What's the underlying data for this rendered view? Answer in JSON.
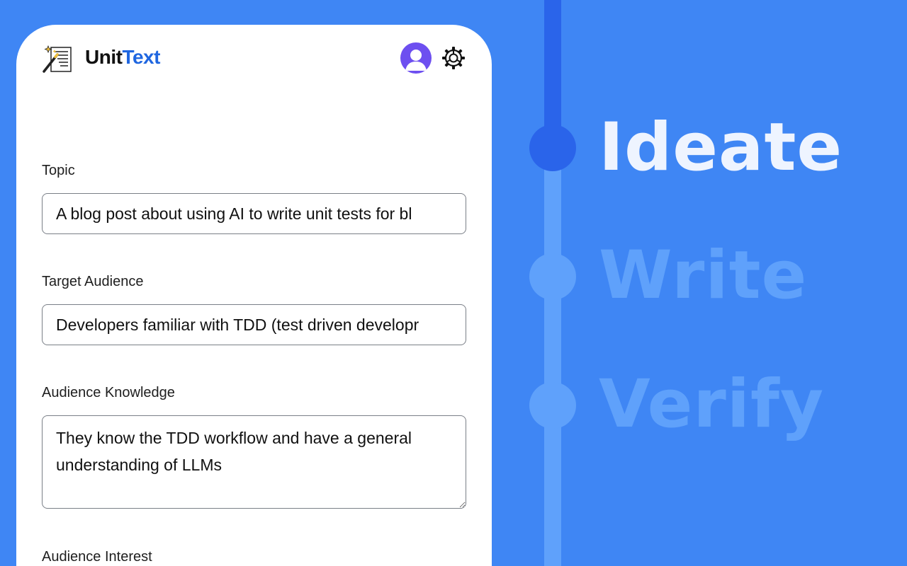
{
  "app": {
    "brand_part1": "Unit",
    "brand_part2": "Text",
    "icons": {
      "logo": "magic-wand-document-icon",
      "avatar": "user-avatar-icon",
      "settings": "gear-icon"
    }
  },
  "form": {
    "topic_label": "Topic",
    "topic_value": "A blog post about using AI to write unit tests for bl",
    "audience_label": "Target Audience",
    "audience_value": "Developers familiar with TDD (test driven developr",
    "knowledge_label": "Audience Knowledge",
    "knowledge_value": "They know the TDD workflow and have a general understanding of LLMs",
    "interest_label": "Audience Interest"
  },
  "steps": [
    {
      "label": "Ideate",
      "active": true
    },
    {
      "label": "Write",
      "active": false
    },
    {
      "label": "Verify",
      "active": false
    }
  ],
  "colors": {
    "background": "#3f86f4",
    "brand_accent": "#1f66e0",
    "avatar": "#6d4ff0",
    "track_active": "#2a64ea",
    "track_inactive": "#5fa1fb"
  }
}
